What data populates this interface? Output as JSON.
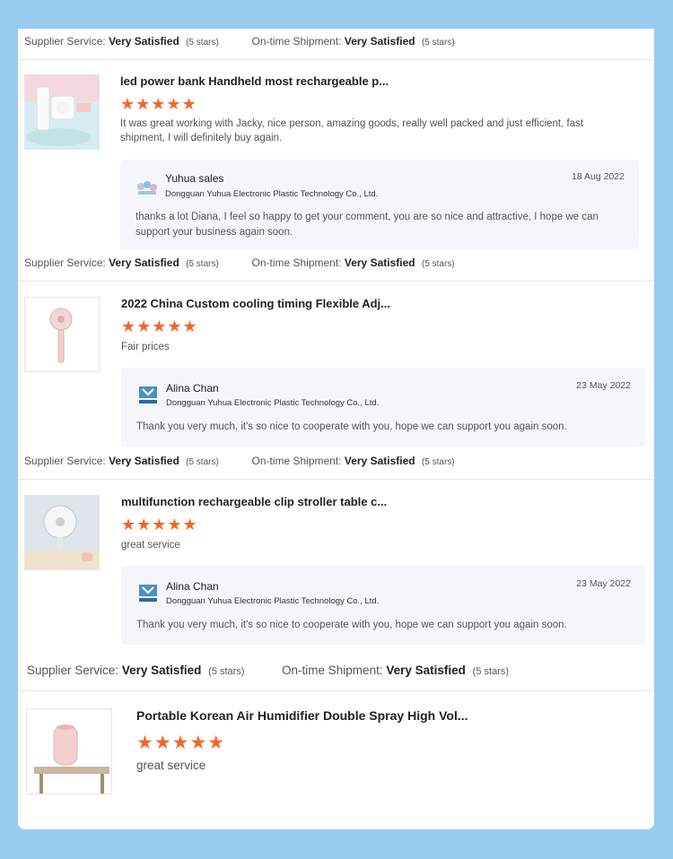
{
  "colors": {
    "background": "#97ccf1",
    "star": "#f0672b",
    "reply_bg": "#f4f6f9"
  },
  "rating_labels": {
    "supplier": "Supplier Service:",
    "shipment": "On-time Shipment:",
    "value": "Very Satisfied",
    "stars_note": "(5 stars)"
  },
  "reviews": [
    {
      "product_icon": "power-bank-product-photo",
      "title": "led power bank Handheld most rechargeable p...",
      "rating": 5,
      "stars_text": "★★★★★",
      "text": "It was great working with Jacky,  nice person, amazing goods, really well packed and just efficient, fast shipment,  I will definitely buy again.",
      "reply": {
        "name": "Yuhua sales",
        "company": "Dongguan Yuhua Electronic Plastic Technology Co., Ltd.",
        "date": "18 Aug 2022",
        "message": "thanks a lot Diana,  I feel so happy to get your comment,  you are so nice and attractive, I hope we can support your business again soon."
      }
    },
    {
      "product_icon": "handheld-fan-product-photo",
      "title": "2022 China Custom cooling timing Flexible Adj...",
      "rating": 5,
      "stars_text": "★★★★★",
      "text": "Fair prices",
      "reply": {
        "name": "Alina Chan",
        "company": "Dongguan Yuhua Electronic Plastic Technology Co., Ltd.",
        "date": "23 May 2022",
        "message": "Thank you very much, it's so nice to cooperate with you, hope we can support you again soon."
      }
    },
    {
      "product_icon": "clip-fan-product-photo",
      "title": "multifunction rechargeable clip stroller table c...",
      "rating": 5,
      "stars_text": "★★★★★",
      "text": "great service",
      "reply": {
        "name": "Alina Chan",
        "company": "Dongguan Yuhua Electronic Plastic Technology Co., Ltd.",
        "date": "23 May 2022",
        "message": "Thank you very much, it's so nice to cooperate with you, hope we can support you again soon."
      }
    },
    {
      "product_icon": "humidifier-product-photo",
      "title": "Portable Korean Air Humidifier Double Spray High Vol...",
      "rating": 5,
      "stars_text": "★★★★★",
      "text": "great service"
    }
  ]
}
